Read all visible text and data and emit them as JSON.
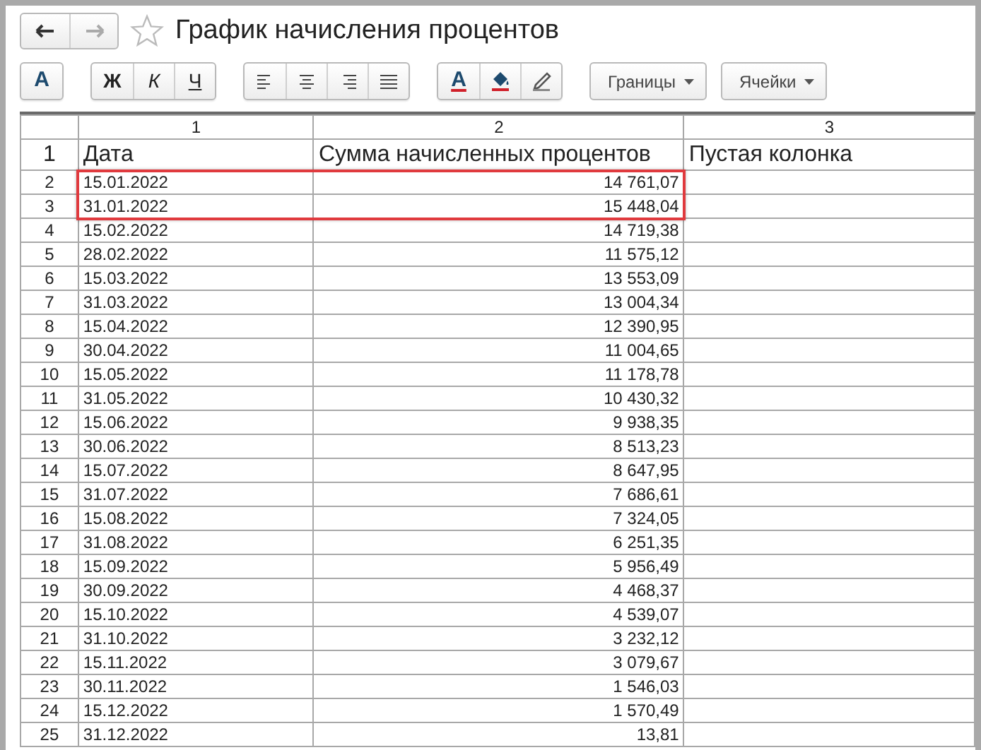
{
  "window": {
    "title": "График начисления процентов",
    "back_disabled": false,
    "forward_disabled": true,
    "favorite": false
  },
  "toolbar": {
    "groups": [
      [
        {
          "kind": "font",
          "label": "A"
        }
      ],
      [
        {
          "kind": "bold",
          "label": "Ж"
        },
        {
          "kind": "italic",
          "label": "К"
        },
        {
          "kind": "underline",
          "label": "Ч"
        }
      ],
      [
        {
          "kind": "align-left"
        },
        {
          "kind": "align-center"
        },
        {
          "kind": "align-right"
        },
        {
          "kind": "align-justify"
        }
      ],
      [
        {
          "kind": "text-color",
          "label": "A"
        },
        {
          "kind": "fill-color"
        },
        {
          "kind": "pencil"
        }
      ]
    ],
    "dropdowns": [
      "Границы",
      "Ячейки"
    ]
  },
  "table": {
    "columns": [
      "1",
      "2",
      "3"
    ],
    "rows": [
      {
        "kind": "header",
        "number": "1",
        "cells": [
          "Дата",
          "Сумма начисленных процентов",
          "Пустая колонка"
        ],
        "highlighted": false
      },
      {
        "kind": "data",
        "number": "2",
        "cells": [
          "15.01.2022",
          "14 761,07"
        ],
        "highlighted": true
      },
      {
        "kind": "data",
        "number": "3",
        "cells": [
          "31.01.2022",
          "15 448,04"
        ],
        "highlighted": true
      },
      {
        "kind": "data",
        "number": "4",
        "cells": [
          "15.02.2022",
          "14 719,38"
        ],
        "highlighted": false
      },
      {
        "kind": "data",
        "number": "5",
        "cells": [
          "28.02.2022",
          "11 575,12"
        ],
        "highlighted": false
      },
      {
        "kind": "data",
        "number": "6",
        "cells": [
          "15.03.2022",
          "13 553,09"
        ],
        "highlighted": false
      },
      {
        "kind": "data",
        "number": "7",
        "cells": [
          "31.03.2022",
          "13 004,34"
        ],
        "highlighted": false
      },
      {
        "kind": "data",
        "number": "8",
        "cells": [
          "15.04.2022",
          "12 390,95"
        ],
        "highlighted": false
      },
      {
        "kind": "data",
        "number": "9",
        "cells": [
          "30.04.2022",
          "11 004,65"
        ],
        "highlighted": false
      },
      {
        "kind": "data",
        "number": "10",
        "cells": [
          "15.05.2022",
          "11 178,78"
        ],
        "highlighted": false
      },
      {
        "kind": "data",
        "number": "11",
        "cells": [
          "31.05.2022",
          "10 430,32"
        ],
        "highlighted": false
      },
      {
        "kind": "data",
        "number": "12",
        "cells": [
          "15.06.2022",
          "9 938,35"
        ],
        "highlighted": false
      },
      {
        "kind": "data",
        "number": "13",
        "cells": [
          "30.06.2022",
          "8 513,23"
        ],
        "highlighted": false
      },
      {
        "kind": "data",
        "number": "14",
        "cells": [
          "15.07.2022",
          "8 647,95"
        ],
        "highlighted": false
      },
      {
        "kind": "data",
        "number": "15",
        "cells": [
          "31.07.2022",
          "7 686,61"
        ],
        "highlighted": false
      },
      {
        "kind": "data",
        "number": "16",
        "cells": [
          "15.08.2022",
          "7 324,05"
        ],
        "highlighted": false
      },
      {
        "kind": "data",
        "number": "17",
        "cells": [
          "31.08.2022",
          "6 251,35"
        ],
        "highlighted": false
      },
      {
        "kind": "data",
        "number": "18",
        "cells": [
          "15.09.2022",
          "5 956,49"
        ],
        "highlighted": false
      },
      {
        "kind": "data",
        "number": "19",
        "cells": [
          "30.09.2022",
          "4 468,37"
        ],
        "highlighted": false
      },
      {
        "kind": "data",
        "number": "20",
        "cells": [
          "15.10.2022",
          "4 539,07"
        ],
        "highlighted": false
      },
      {
        "kind": "data",
        "number": "21",
        "cells": [
          "31.10.2022",
          "3 232,12"
        ],
        "highlighted": false
      },
      {
        "kind": "data",
        "number": "22",
        "cells": [
          "15.11.2022",
          "3 079,67"
        ],
        "highlighted": false
      },
      {
        "kind": "data",
        "number": "23",
        "cells": [
          "30.11.2022",
          "1 546,03"
        ],
        "highlighted": false
      },
      {
        "kind": "data",
        "number": "24",
        "cells": [
          "15.12.2022",
          "1 570,49"
        ],
        "highlighted": false
      },
      {
        "kind": "data",
        "number": "25",
        "cells": [
          "31.12.2022",
          "13,81"
        ],
        "highlighted": false
      }
    ]
  }
}
